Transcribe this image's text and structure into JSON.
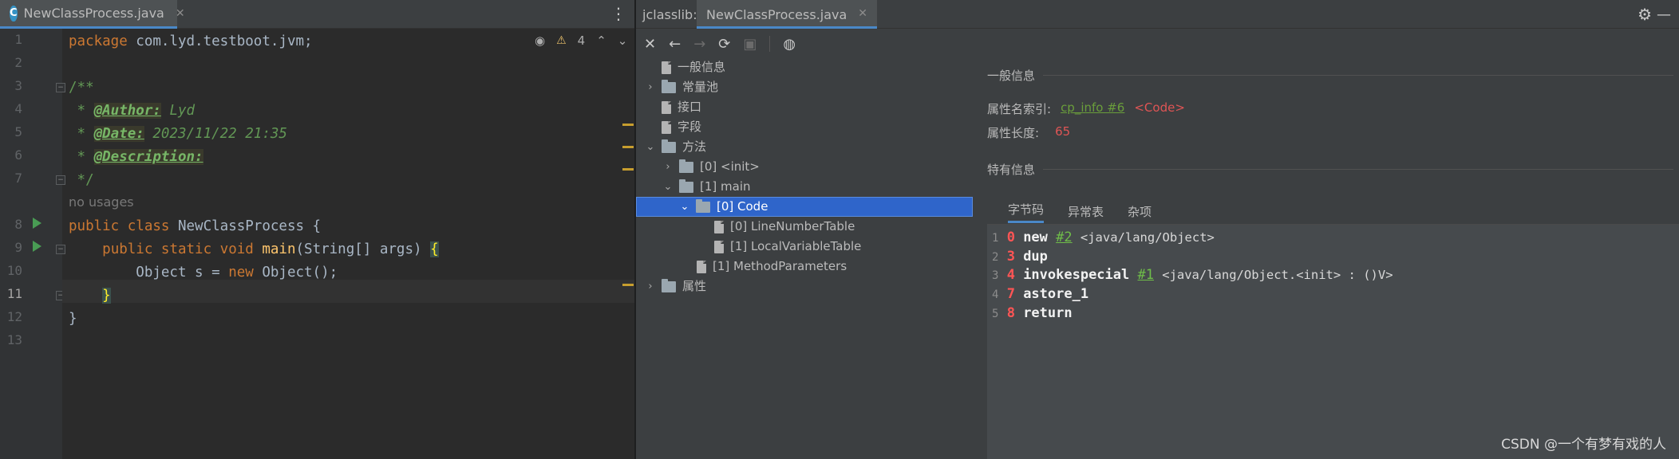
{
  "editor": {
    "tab_title": "NewClassProcess.java",
    "tab_icon_letter": "C",
    "warnings_count": "4",
    "line_numbers": [
      "1",
      "2",
      "3",
      "4",
      "5",
      "6",
      "7",
      "8",
      "9",
      "10",
      "11",
      "12",
      "13"
    ],
    "code": {
      "l1_kw": "package",
      "l1_rest": " com.lyd.testboot.jvm;",
      "l3": "/**",
      "l4_star": " * ",
      "l4_tag": "@Author:",
      "l4_text": " Lyd",
      "l5_star": " * ",
      "l5_tag": "@Date:",
      "l5_text": " 2023/11/22 21:35",
      "l6_star": " * ",
      "l6_tag": "@Description:",
      "l7": " */",
      "usages": "no usages",
      "l8_kw": "public class",
      "l8_rest": " NewClassProcess {",
      "l9_indent": "    ",
      "l9_kw": "public static void",
      "l9_fn": " main",
      "l9_rest": "(String[] args) ",
      "l9_brace": "{",
      "l10_pre": "        Object s = ",
      "l10_kw": "new",
      "l10_rest": " Object();",
      "l11_indent": "    ",
      "l11_brace": "}",
      "l12": "}"
    }
  },
  "jclasslib": {
    "label": "jclasslib:",
    "tab_title": "NewClassProcess.java",
    "tree": {
      "general": "一般信息",
      "constant_pool": "常量池",
      "interfaces": "接口",
      "fields": "字段",
      "methods": "方法",
      "init": "[0] <init>",
      "main": "[1] main",
      "code": "[0] Code",
      "line_number_table": "[0] LineNumberTable",
      "local_variable_table": "[1] LocalVariableTable",
      "method_parameters": "[1] MethodParameters",
      "attributes": "属性"
    },
    "panel": {
      "general_title": "一般信息",
      "attr_name_index_label": "属性名索引:",
      "attr_name_index_link": "cp_info #6",
      "attr_name_index_value": "<Code>",
      "attr_length_label": "属性长度:",
      "attr_length_value": "65",
      "specific_title": "特有信息",
      "subtabs": [
        "字节码",
        "异常表",
        "杂项"
      ]
    },
    "bytecode": [
      {
        "line": "1",
        "offset": "0",
        "op": "new",
        "ref": "#2",
        "comment": "<java/lang/Object>"
      },
      {
        "line": "2",
        "offset": "3",
        "op": "dup",
        "ref": "",
        "comment": ""
      },
      {
        "line": "3",
        "offset": "4",
        "op": "invokespecial",
        "ref": "#1",
        "comment": "<java/lang/Object.<init> : ()V>"
      },
      {
        "line": "4",
        "offset": "7",
        "op": "astore_1",
        "ref": "",
        "comment": ""
      },
      {
        "line": "5",
        "offset": "8",
        "op": "return",
        "ref": "",
        "comment": ""
      }
    ]
  },
  "watermark": "CSDN @一个有梦有戏的人"
}
